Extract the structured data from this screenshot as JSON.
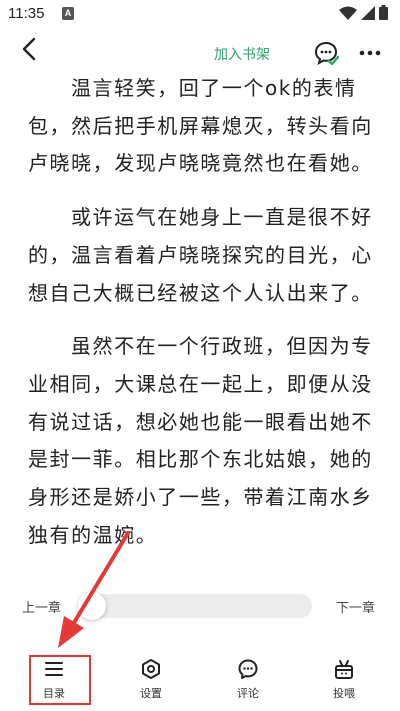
{
  "status_bar": {
    "time": "11:35",
    "notification_letter": "A"
  },
  "top_bar": {
    "add_to_shelf": "加入书架"
  },
  "reader": {
    "paragraphs": [
      "温言轻笑，回了一个ok的表情包，然后把手机屏幕熄灭，转头看向卢晓晓，发现卢晓晓竟然也在看她。",
      "或许运气在她身上一直是很不好的，温言看着卢晓晓探究的目光，心想自己大概已经被这个人认出来了。",
      "虽然不在一个行政班，但因为专业相同，大课总在一起上，即便从没有说过话，想必她也能一眼看出她不是封一菲。相比那个东北姑娘，她的身形还是娇小了一些，带着江南水乡独有的温婉。"
    ]
  },
  "chapter_nav": {
    "prev": "上一章",
    "next": "下一章",
    "progress": 0.0
  },
  "bottom_bar": {
    "tabs": [
      {
        "label": "目录",
        "icon": "menu-icon"
      },
      {
        "label": "设置",
        "icon": "settings-icon"
      },
      {
        "label": "评论",
        "icon": "comment-icon"
      },
      {
        "label": "投喂",
        "icon": "gift-icon"
      }
    ]
  },
  "colors": {
    "accent": "#2fa36b",
    "annotation": "#e53935",
    "track": "#ececec"
  }
}
